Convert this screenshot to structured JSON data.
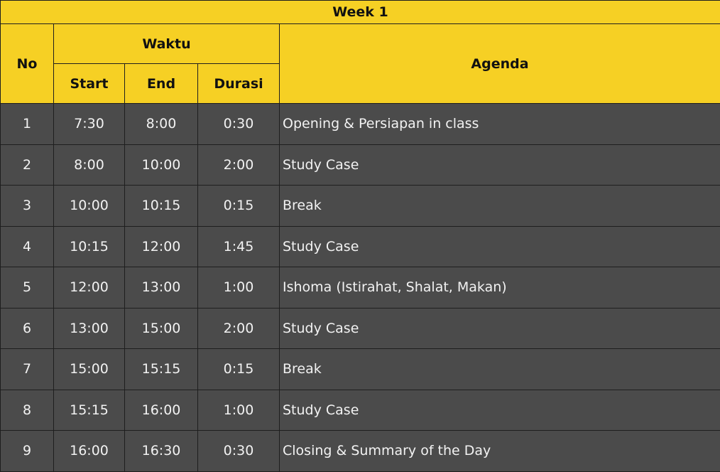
{
  "header": {
    "title": "Week 1",
    "no": "No",
    "waktu": "Waktu",
    "start": "Start",
    "end": "End",
    "durasi": "Durasi",
    "agenda": "Agenda"
  },
  "rows": [
    {
      "no": "1",
      "start": "7:30",
      "end": "8:00",
      "durasi": "0:30",
      "agenda": "Opening & Persiapan in class"
    },
    {
      "no": "2",
      "start": "8:00",
      "end": "10:00",
      "durasi": "2:00",
      "agenda": "Study Case"
    },
    {
      "no": "3",
      "start": "10:00",
      "end": "10:15",
      "durasi": "0:15",
      "agenda": "Break"
    },
    {
      "no": "4",
      "start": "10:15",
      "end": "12:00",
      "durasi": "1:45",
      "agenda": "Study Case"
    },
    {
      "no": "5",
      "start": "12:00",
      "end": "13:00",
      "durasi": "1:00",
      "agenda": "Ishoma (Istirahat, Shalat, Makan)"
    },
    {
      "no": "6",
      "start": "13:00",
      "end": "15:00",
      "durasi": "2:00",
      "agenda": "Study Case"
    },
    {
      "no": "7",
      "start": "15:00",
      "end": "15:15",
      "durasi": "0:15",
      "agenda": "Break"
    },
    {
      "no": "8",
      "start": "15:15",
      "end": "16:00",
      "durasi": "1:00",
      "agenda": "Study Case"
    },
    {
      "no": "9",
      "start": "16:00",
      "end": "16:30",
      "durasi": "0:30",
      "agenda": "Closing & Summary of the Day"
    }
  ]
}
